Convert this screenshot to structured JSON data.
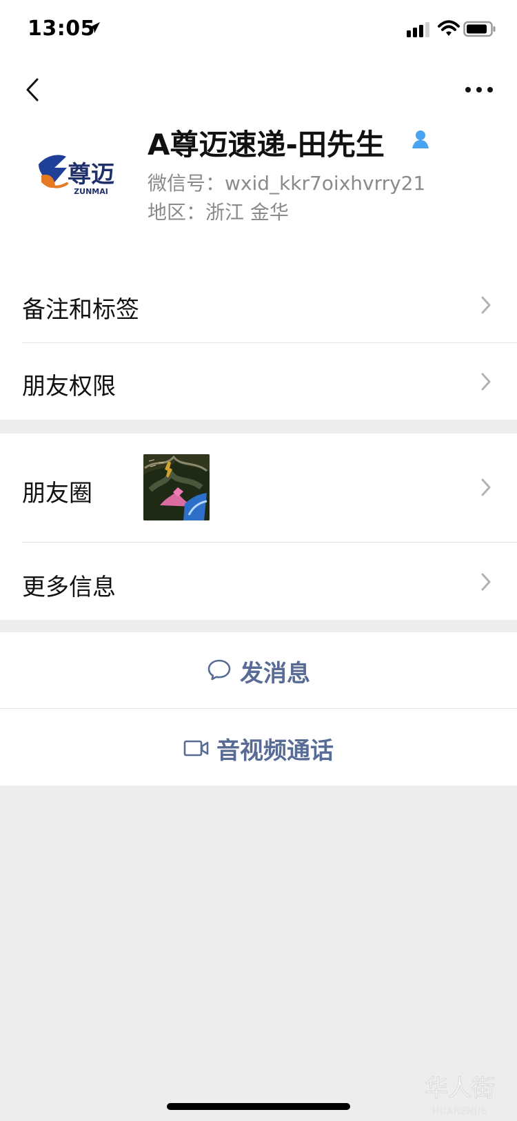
{
  "status_bar": {
    "time": "13:05"
  },
  "header": {
    "back_icon": "chevron-left-icon",
    "more_icon": "more-horizontal-icon"
  },
  "profile": {
    "name": "A尊迈速递-田先生",
    "wechat_id": "微信号：wxid_kkr7oixhvrry21",
    "region": "地区：浙江 金华",
    "avatar_text": "尊迈",
    "avatar_subtext": "ZUNMAI",
    "verified_icon": "user-icon"
  },
  "menu": {
    "note_and_tags": "备注和标签",
    "friend_permissions": "朋友权限",
    "moments": "朋友圈",
    "more_info": "更多信息"
  },
  "actions": {
    "send_message": "发消息",
    "voice_video_call": "音视频通话"
  },
  "colors": {
    "background": "#ededed",
    "card": "#ffffff",
    "divider": "#e5e5e5",
    "text": "#111111",
    "secondary_text": "#8a8a8a",
    "action": "#576b95",
    "verified": "#4aa3f2",
    "brand_blue": "#1f3f98",
    "brand_orange": "#e57a22"
  },
  "watermark": {
    "text": "华人街",
    "subtext": "HUARENJIE"
  }
}
